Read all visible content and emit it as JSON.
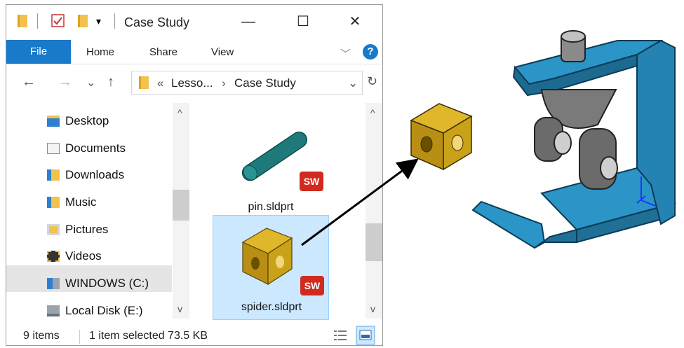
{
  "window": {
    "title": "Case Study",
    "minimize_glyph": "—",
    "maximize_glyph": "☐",
    "close_glyph": "✕",
    "dropdown_glyph": "▾"
  },
  "ribbon": {
    "tabs": [
      "File",
      "Home",
      "Share",
      "View"
    ],
    "expand_glyph": "﹀",
    "help_label": "?"
  },
  "address": {
    "back_glyph": "←",
    "forward_glyph": "→",
    "recent_glyph": "⌄",
    "up_glyph": "↑",
    "chevron_left": "«",
    "crumbs": [
      "Lesso...",
      "Case Study"
    ],
    "separator": "›",
    "dropdown_glyph": "⌄",
    "refresh_glyph": "↻"
  },
  "nav": {
    "items": [
      {
        "label": "Desktop",
        "icon": "desktop-folder-icon"
      },
      {
        "label": "Documents",
        "icon": "documents-folder-icon"
      },
      {
        "label": "Downloads",
        "icon": "downloads-folder-icon"
      },
      {
        "label": "Music",
        "icon": "music-folder-icon"
      },
      {
        "label": "Pictures",
        "icon": "pictures-folder-icon"
      },
      {
        "label": "Videos",
        "icon": "videos-folder-icon"
      },
      {
        "label": "WINDOWS (C:)",
        "icon": "windows-drive-icon"
      },
      {
        "label": "Local Disk (E:)",
        "icon": "local-disk-icon"
      }
    ],
    "scroll_up": "^",
    "scroll_down": "v"
  },
  "files": [
    {
      "name": "pin.sldprt",
      "badge": "SW"
    },
    {
      "name": "spider.sldprt",
      "badge": "SW"
    }
  ],
  "status": {
    "items": "9 items",
    "selected": "1 item selected  73.5 KB"
  },
  "colors": {
    "accent": "#1979ca",
    "pin": "#1e7a7a",
    "cube": "#c9a21a",
    "bracket": "#2a95c6"
  }
}
